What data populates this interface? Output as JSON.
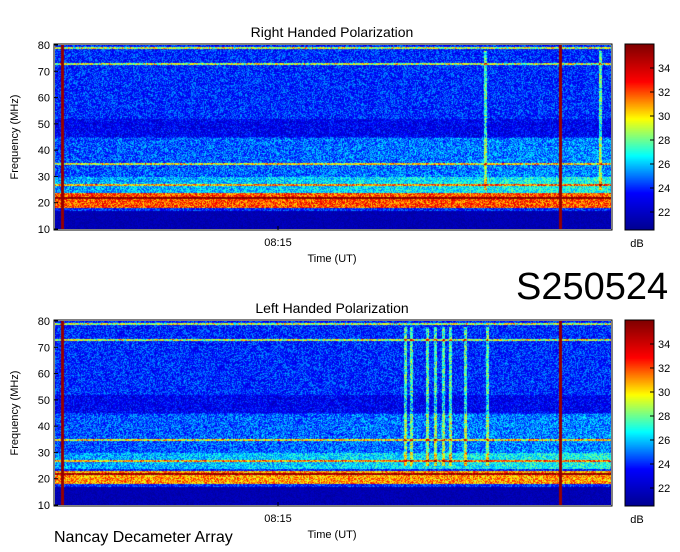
{
  "code": "S250524",
  "credit": "Nancay Decameter Array",
  "colorscale": {
    "unit": "dB",
    "ticks": [
      22,
      24,
      26,
      28,
      30,
      32,
      34
    ],
    "range": [
      20.5,
      36
    ],
    "colors": [
      "#00008f",
      "#0000ff",
      "#00ffff",
      "#ffff00",
      "#ff0000",
      "#800000"
    ]
  },
  "chart_data": [
    {
      "type": "heatmap",
      "title": "Right Handed Polarization",
      "xlabel": "Time (UT)",
      "ylabel": "Frequency (MHz)",
      "xticks": [
        "08:15"
      ],
      "yticks": [
        10,
        20,
        30,
        40,
        50,
        60,
        70,
        80
      ],
      "ylim": [
        10,
        80
      ],
      "zlabel": "dB",
      "features": {
        "background_dB": 24,
        "bright_band_MHz": [
          18,
          24
        ],
        "bright_band_dB": 32,
        "low_band_MHz": [
          10,
          17
        ],
        "low_band_dB": 21.5,
        "persistent_lines_MHz": [
          79,
          73,
          35,
          27,
          22
        ],
        "vertical_bars": [
          "start",
          "end"
        ]
      }
    },
    {
      "type": "heatmap",
      "title": "Left Handed Polarization",
      "xlabel": "Time (UT)",
      "ylabel": "Frequency (MHz)",
      "xticks": [
        "08:15"
      ],
      "yticks": [
        10,
        20,
        30,
        40,
        50,
        60,
        70,
        80
      ],
      "ylim": [
        10,
        80
      ],
      "zlabel": "dB",
      "features": {
        "background_dB": 24,
        "bright_band_MHz": [
          18,
          23
        ],
        "bright_band_dB": 31,
        "low_band_MHz": [
          10,
          17
        ],
        "low_band_dB": 21.5,
        "persistent_lines_MHz": [
          79,
          73,
          35,
          27,
          22
        ],
        "vertical_bars": [
          "start",
          "end"
        ]
      }
    }
  ]
}
